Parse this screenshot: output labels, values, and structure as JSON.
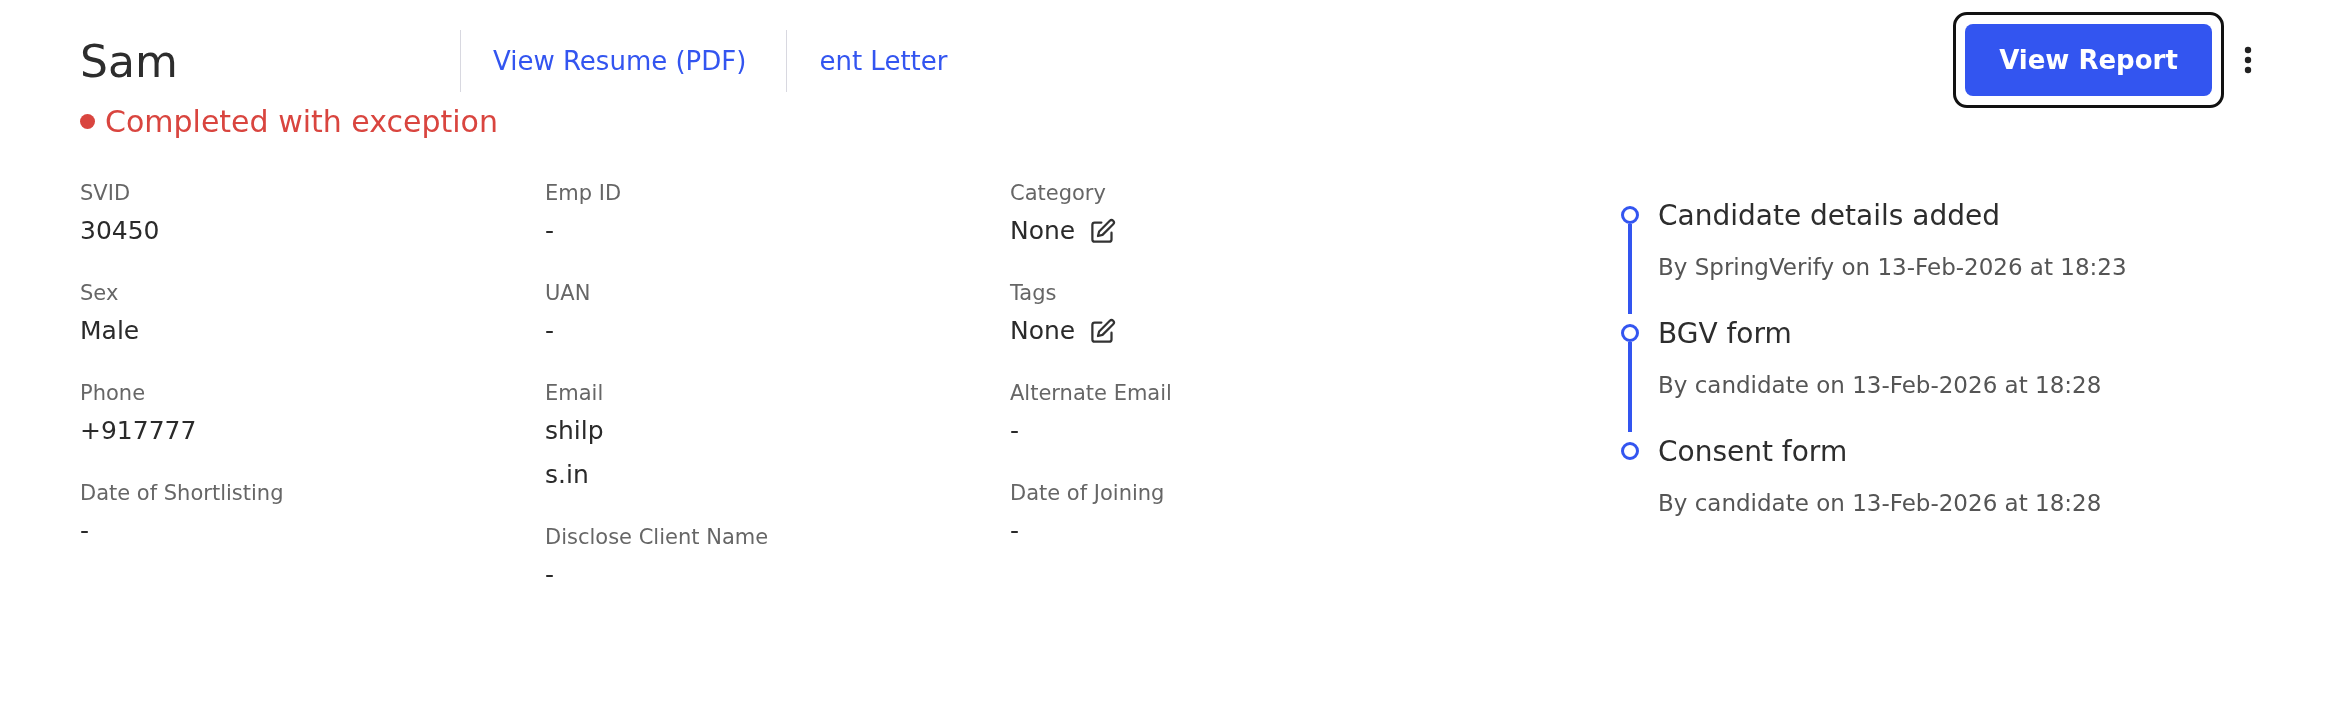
{
  "header": {
    "name": "Sam",
    "links": [
      {
        "label": "View Resume (PDF)"
      },
      {
        "label": "ent Letter"
      }
    ],
    "status": {
      "label": "Completed with exception",
      "color": "#d9453f"
    },
    "button": "View Report"
  },
  "details": [
    [
      {
        "label": "SVID",
        "value": "30450",
        "kind": "text"
      },
      {
        "label": "Sex",
        "value": "Male",
        "kind": "text"
      },
      {
        "label": "Phone",
        "value": "+917777",
        "kind": "text"
      },
      {
        "label": "Date of Shortlisting",
        "value": "-",
        "kind": "text"
      }
    ],
    [
      {
        "label": "Emp ID",
        "value": "-",
        "kind": "text"
      },
      {
        "label": "UAN",
        "value": "-",
        "kind": "text"
      },
      {
        "label": "Email",
        "value": "shilp",
        "value_2": "s.in",
        "kind": "text"
      },
      {
        "label": "Disclose Client Name",
        "value": "-",
        "kind": "text"
      }
    ],
    [
      {
        "label": "Category",
        "value": "None",
        "kind": "editable"
      },
      {
        "label": "Tags",
        "value": "None",
        "kind": "editable"
      },
      {
        "label": "Alternate Email",
        "value": "-",
        "kind": "text"
      },
      {
        "label": "Date of Joining",
        "value": "-",
        "kind": "text"
      }
    ]
  ],
  "timeline": [
    {
      "title": "Candidate details added",
      "subtitle": "By SpringVerify on 13-Feb-2026 at 18:23"
    },
    {
      "title": "BGV form",
      "subtitle": "By candidate on 13-Feb-2026 at 18:28"
    },
    {
      "title": "Consent form",
      "subtitle": "By candidate on 13-Feb-2026 at 18:28"
    }
  ]
}
